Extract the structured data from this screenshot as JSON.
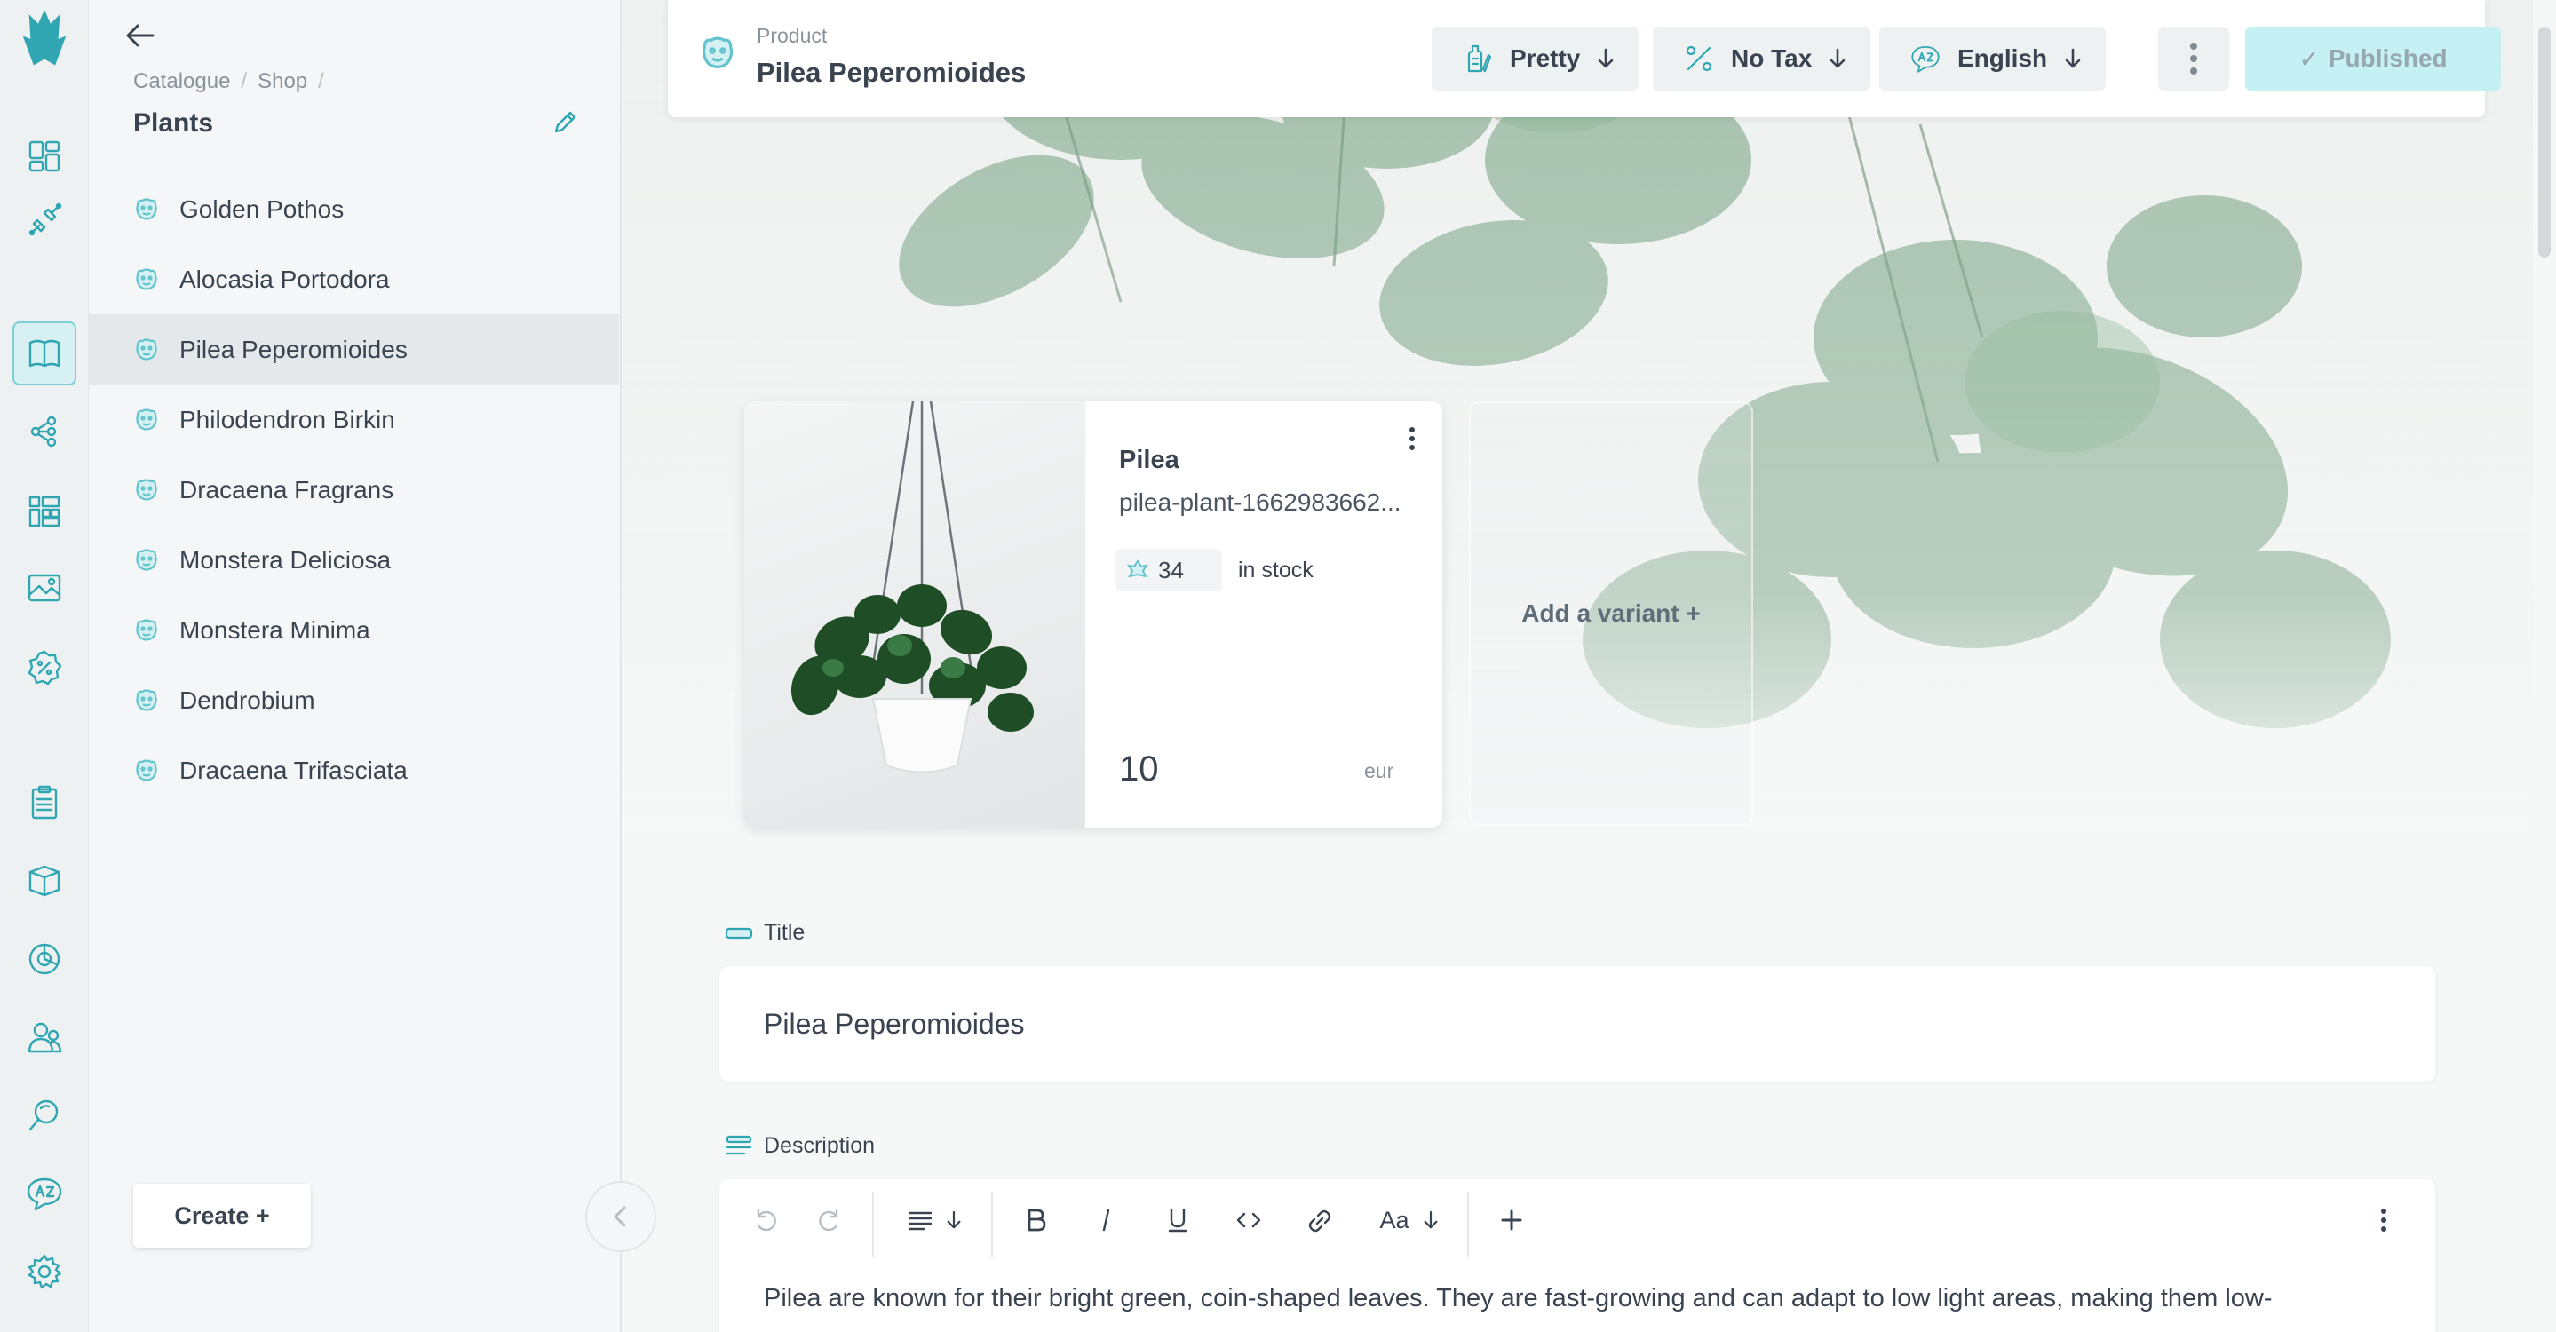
{
  "rail": {
    "icons": [
      "logo-icon",
      "dashboard-icon",
      "integration-icon",
      "catalogue-icon",
      "workflow-icon",
      "grid-icon",
      "media-icon",
      "discount-icon",
      "orders-icon",
      "packages-icon",
      "analytics-icon",
      "customers-icon",
      "search-icon",
      "translate-icon",
      "settings-icon"
    ]
  },
  "panel": {
    "breadcrumb": [
      "Catalogue",
      "Shop"
    ],
    "title": "Plants",
    "items": [
      "Golden Pothos",
      "Alocasia Portodora",
      "Pilea Peperomioides",
      "Philodendron Birkin",
      "Dracaena Fragrans",
      "Monstera Deliciosa",
      "Monstera Minima",
      "Dendrobium",
      "Dracaena Trifasciata"
    ],
    "active_item": "Pilea Peperomioides",
    "create_label": "Create +"
  },
  "header": {
    "kicker": "Product",
    "title": "Pilea Peperomioides",
    "theme_label": "Pretty",
    "tax_label": "No Tax",
    "language_label": "English",
    "status_label": "Published",
    "status_check": "✓"
  },
  "variant": {
    "name": "Pilea",
    "file": "pilea-plant-1662983662...",
    "stock_count": "34",
    "stock_label": "in stock",
    "price": "10",
    "currency": "eur",
    "add_label": "Add a variant +"
  },
  "fields": {
    "title_label": "Title",
    "title_value": "Pilea Peperomioides",
    "description_label": "Description",
    "description_text": "Pilea are known for their bright green, coin-shaped leaves. They are fast-growing and can adapt to low light areas, making them low-",
    "font_button": "Aa"
  },
  "colors": {
    "accent": "#2fa6b2",
    "accent_light": "#d4f0f2",
    "published_bg": "#c6f1f4"
  }
}
